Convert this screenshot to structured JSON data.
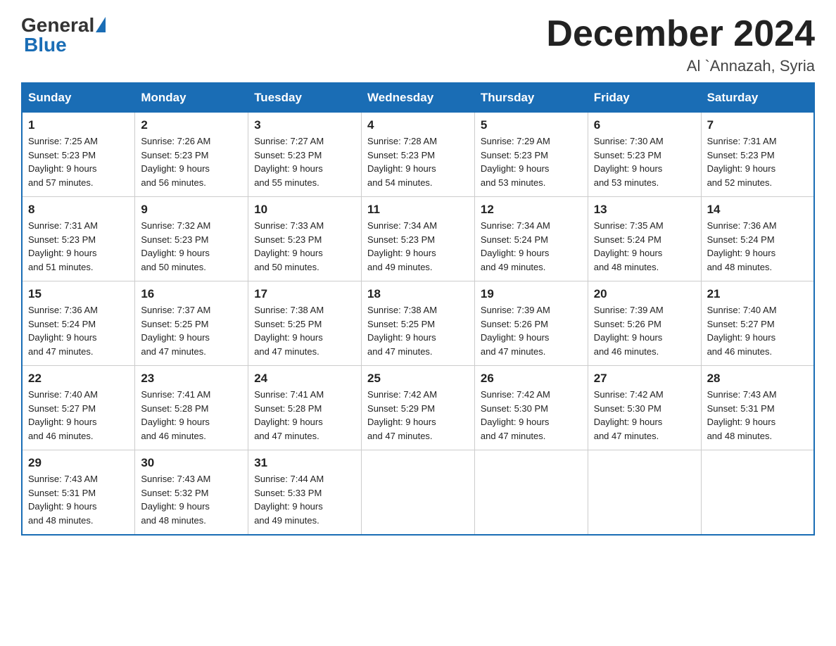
{
  "header": {
    "logo_general": "General",
    "logo_blue": "Blue",
    "month_title": "December 2024",
    "location": "Al `Annazah, Syria"
  },
  "days_of_week": [
    "Sunday",
    "Monday",
    "Tuesday",
    "Wednesday",
    "Thursday",
    "Friday",
    "Saturday"
  ],
  "weeks": [
    [
      {
        "day": "1",
        "sunrise": "7:25 AM",
        "sunset": "5:23 PM",
        "daylight": "9 hours and 57 minutes."
      },
      {
        "day": "2",
        "sunrise": "7:26 AM",
        "sunset": "5:23 PM",
        "daylight": "9 hours and 56 minutes."
      },
      {
        "day": "3",
        "sunrise": "7:27 AM",
        "sunset": "5:23 PM",
        "daylight": "9 hours and 55 minutes."
      },
      {
        "day": "4",
        "sunrise": "7:28 AM",
        "sunset": "5:23 PM",
        "daylight": "9 hours and 54 minutes."
      },
      {
        "day": "5",
        "sunrise": "7:29 AM",
        "sunset": "5:23 PM",
        "daylight": "9 hours and 53 minutes."
      },
      {
        "day": "6",
        "sunrise": "7:30 AM",
        "sunset": "5:23 PM",
        "daylight": "9 hours and 53 minutes."
      },
      {
        "day": "7",
        "sunrise": "7:31 AM",
        "sunset": "5:23 PM",
        "daylight": "9 hours and 52 minutes."
      }
    ],
    [
      {
        "day": "8",
        "sunrise": "7:31 AM",
        "sunset": "5:23 PM",
        "daylight": "9 hours and 51 minutes."
      },
      {
        "day": "9",
        "sunrise": "7:32 AM",
        "sunset": "5:23 PM",
        "daylight": "9 hours and 50 minutes."
      },
      {
        "day": "10",
        "sunrise": "7:33 AM",
        "sunset": "5:23 PM",
        "daylight": "9 hours and 50 minutes."
      },
      {
        "day": "11",
        "sunrise": "7:34 AM",
        "sunset": "5:23 PM",
        "daylight": "9 hours and 49 minutes."
      },
      {
        "day": "12",
        "sunrise": "7:34 AM",
        "sunset": "5:24 PM",
        "daylight": "9 hours and 49 minutes."
      },
      {
        "day": "13",
        "sunrise": "7:35 AM",
        "sunset": "5:24 PM",
        "daylight": "9 hours and 48 minutes."
      },
      {
        "day": "14",
        "sunrise": "7:36 AM",
        "sunset": "5:24 PM",
        "daylight": "9 hours and 48 minutes."
      }
    ],
    [
      {
        "day": "15",
        "sunrise": "7:36 AM",
        "sunset": "5:24 PM",
        "daylight": "9 hours and 47 minutes."
      },
      {
        "day": "16",
        "sunrise": "7:37 AM",
        "sunset": "5:25 PM",
        "daylight": "9 hours and 47 minutes."
      },
      {
        "day": "17",
        "sunrise": "7:38 AM",
        "sunset": "5:25 PM",
        "daylight": "9 hours and 47 minutes."
      },
      {
        "day": "18",
        "sunrise": "7:38 AM",
        "sunset": "5:25 PM",
        "daylight": "9 hours and 47 minutes."
      },
      {
        "day": "19",
        "sunrise": "7:39 AM",
        "sunset": "5:26 PM",
        "daylight": "9 hours and 47 minutes."
      },
      {
        "day": "20",
        "sunrise": "7:39 AM",
        "sunset": "5:26 PM",
        "daylight": "9 hours and 46 minutes."
      },
      {
        "day": "21",
        "sunrise": "7:40 AM",
        "sunset": "5:27 PM",
        "daylight": "9 hours and 46 minutes."
      }
    ],
    [
      {
        "day": "22",
        "sunrise": "7:40 AM",
        "sunset": "5:27 PM",
        "daylight": "9 hours and 46 minutes."
      },
      {
        "day": "23",
        "sunrise": "7:41 AM",
        "sunset": "5:28 PM",
        "daylight": "9 hours and 46 minutes."
      },
      {
        "day": "24",
        "sunrise": "7:41 AM",
        "sunset": "5:28 PM",
        "daylight": "9 hours and 47 minutes."
      },
      {
        "day": "25",
        "sunrise": "7:42 AM",
        "sunset": "5:29 PM",
        "daylight": "9 hours and 47 minutes."
      },
      {
        "day": "26",
        "sunrise": "7:42 AM",
        "sunset": "5:30 PM",
        "daylight": "9 hours and 47 minutes."
      },
      {
        "day": "27",
        "sunrise": "7:42 AM",
        "sunset": "5:30 PM",
        "daylight": "9 hours and 47 minutes."
      },
      {
        "day": "28",
        "sunrise": "7:43 AM",
        "sunset": "5:31 PM",
        "daylight": "9 hours and 48 minutes."
      }
    ],
    [
      {
        "day": "29",
        "sunrise": "7:43 AM",
        "sunset": "5:31 PM",
        "daylight": "9 hours and 48 minutes."
      },
      {
        "day": "30",
        "sunrise": "7:43 AM",
        "sunset": "5:32 PM",
        "daylight": "9 hours and 48 minutes."
      },
      {
        "day": "31",
        "sunrise": "7:44 AM",
        "sunset": "5:33 PM",
        "daylight": "9 hours and 49 minutes."
      },
      null,
      null,
      null,
      null
    ]
  ],
  "labels": {
    "sunrise": "Sunrise:",
    "sunset": "Sunset:",
    "daylight": "Daylight:"
  },
  "colors": {
    "header_bg": "#1a6db5",
    "header_text": "#ffffff",
    "border": "#1a6db5",
    "body_text": "#222222"
  }
}
